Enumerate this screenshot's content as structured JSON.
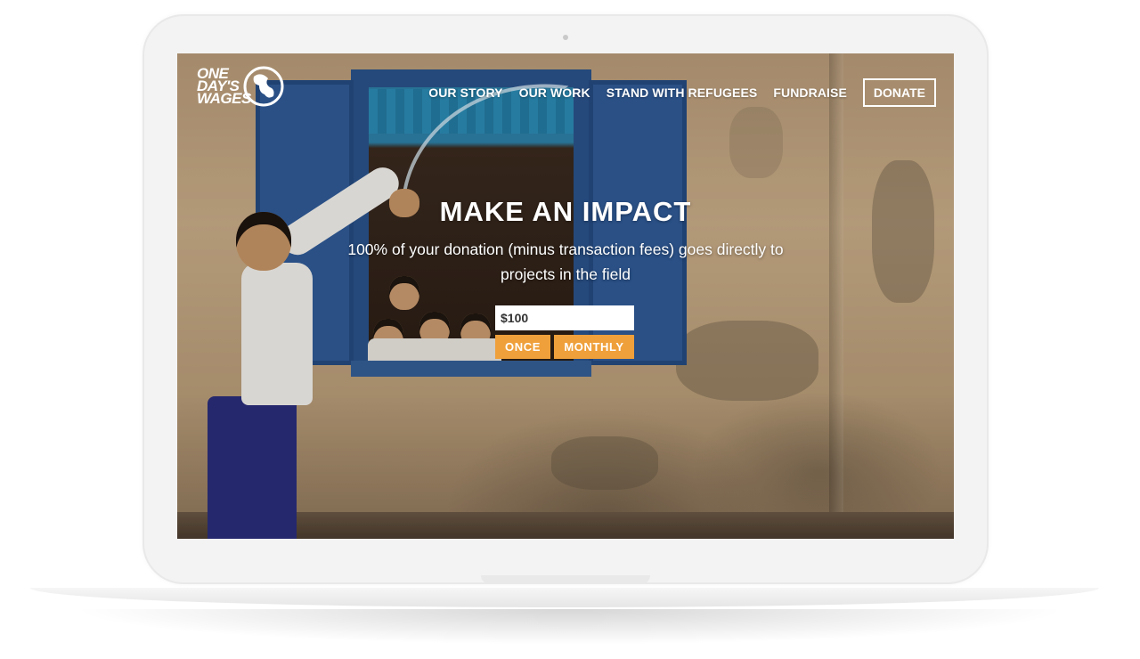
{
  "header": {
    "logo_text": "ONE DAY'S WAGES",
    "nav": [
      {
        "label": "OUR STORY"
      },
      {
        "label": "OUR WORK"
      },
      {
        "label": "STAND WITH REFUGEES"
      },
      {
        "label": "FUNDRAISE"
      }
    ],
    "donate_label": "DONATE"
  },
  "hero": {
    "title": "MAKE AN IMPACT",
    "subtitle": "100% of your donation (minus transaction fees) goes directly to projects in the field",
    "amount_value": "$100",
    "once_label": "ONCE",
    "monthly_label": "MONTHLY"
  },
  "colors": {
    "accent": "#efa03b",
    "text": "#ffffff"
  },
  "icons": {
    "logo": "globe-logo-icon"
  }
}
